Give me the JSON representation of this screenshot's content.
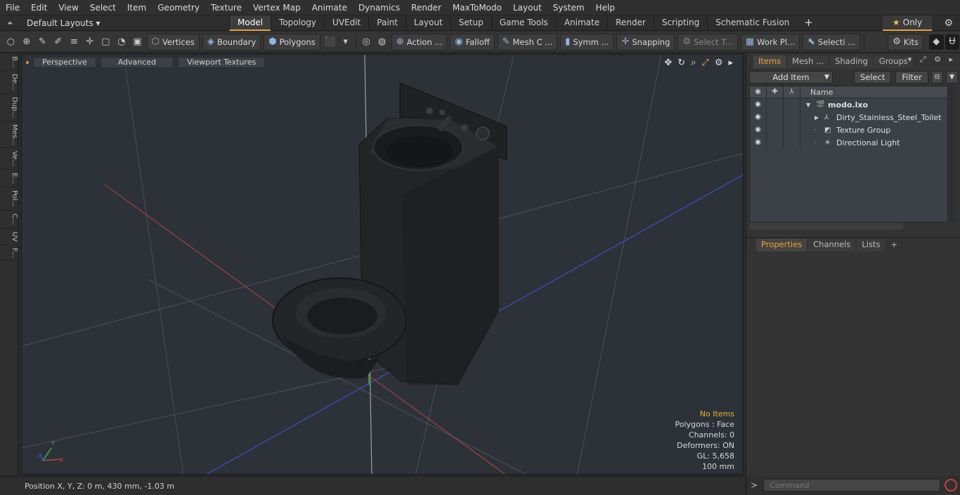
{
  "menubar": [
    "File",
    "Edit",
    "View",
    "Select",
    "Item",
    "Geometry",
    "Texture",
    "Vertex Map",
    "Animate",
    "Dynamics",
    "Render",
    "MaxToModo",
    "Layout",
    "System",
    "Help"
  ],
  "layout": {
    "default_layouts": "Default Layouts ▾",
    "tabs": [
      "Model",
      "Topology",
      "UVEdit",
      "Paint",
      "Layout",
      "Setup",
      "Game Tools",
      "Animate",
      "Render",
      "Scripting",
      "Schematic Fusion"
    ],
    "active_tab": "Model",
    "plus": "+",
    "only": "Only"
  },
  "toolbar": {
    "vertices": "Vertices",
    "boundary": "Boundary",
    "polygons": "Polygons",
    "action": "Action ...",
    "falloff": "Falloff",
    "mesh": "Mesh C ...",
    "symm": "Symm ...",
    "snapping": "Snapping",
    "select_t": "Select T...",
    "work_pl": "Work Pl...",
    "selecti": "Selecti ...",
    "kits": "Kits"
  },
  "leftstrip": [
    "B...",
    "De...",
    "Dup...",
    "Mes...",
    "Ve...",
    "E...",
    "Pol...",
    "C...",
    "UV",
    "F..."
  ],
  "viewport": {
    "perspective": "Perspective",
    "advanced": "Advanced",
    "viewport_textures": "Viewport Textures",
    "info": {
      "no_items": "No Items",
      "polygons": "Polygons : Face",
      "channels": "Channels: 0",
      "deformers": "Deformers: ON",
      "gl": "GL: 5,658",
      "scale": "100 mm"
    }
  },
  "status": {
    "position": "Position X, Y, Z:   0 m, 430 mm, -1.03 m"
  },
  "right_panel": {
    "tabs": [
      "Items",
      "Mesh ...",
      "Shading",
      "Groups"
    ],
    "active_tab": "Items",
    "add_item": "Add Item",
    "select": "Select",
    "filter": "Filter",
    "name_header": "Name",
    "items": [
      {
        "name": "modo.lxo",
        "bold": true
      },
      {
        "name": "Dirty_Stainless_Steel_Toilet"
      },
      {
        "name": "Texture Group"
      },
      {
        "name": "Directional Light"
      }
    ],
    "prop_tabs": [
      "Properties",
      "Channels",
      "Lists"
    ],
    "active_prop_tab": "Properties",
    "command_placeholder": "Command"
  },
  "colors": {
    "accent": "#e8a33a",
    "viewport_bg": "#2c3238",
    "axis_red": "#b8443e",
    "axis_blue": "#3f4fc8",
    "axis_green": "#3fb04a"
  }
}
